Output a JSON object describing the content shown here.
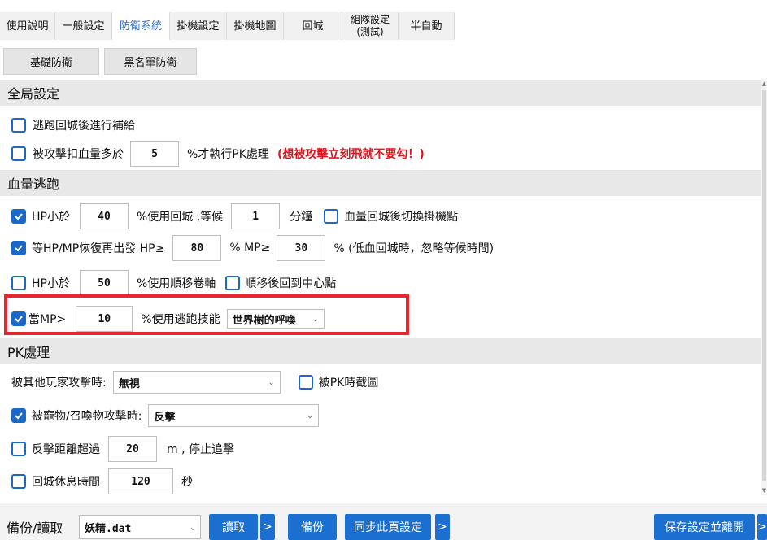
{
  "colors": {
    "accent": "#1a68c8",
    "active_tab_text": "#2f6fd1",
    "warning": "#e0141e",
    "highlight_box": "#e6282e"
  },
  "tabs": [
    {
      "label": "使用說明"
    },
    {
      "label": "一般設定"
    },
    {
      "label": "防衛系統",
      "active": true
    },
    {
      "label": "掛機設定"
    },
    {
      "label": "掛機地圖"
    },
    {
      "label": "回城"
    },
    {
      "label_line1": "組隊設定",
      "label_line2": "(測試)"
    },
    {
      "label": "半自動"
    }
  ],
  "subtabs": [
    "基礎防衛",
    "黑名單防衛"
  ],
  "global": {
    "header": "全局設定",
    "refill_after_return": {
      "label": "逃跑回城後進行補給",
      "checked": false
    },
    "pk_on_hit": {
      "label_before": "被攻擊扣血量多於",
      "value": "5",
      "label_after": "%才執行PK處理",
      "warning": "(想被攻擊立刻飛就不要勾！)",
      "checked": false
    }
  },
  "escape": {
    "header": "血量逃跑",
    "hp_return": {
      "label": "HP小於",
      "value": "40",
      "label_mid": "%使用回城 ,等候",
      "wait": "1",
      "unit": "分鐘",
      "checked": true,
      "switch_label": "血量回城後切換掛機點",
      "switch_checked": false
    },
    "recover": {
      "label": "等HP/MP恢復再出發 HP≥",
      "hp": "80",
      "mp_label": "% MP≥",
      "mp": "30",
      "note": "% (低血回城時，忽略等候時間)",
      "checked": true
    },
    "hp_teleport": {
      "label": "HP小於",
      "value": "50",
      "label_after": "%使用順移卷軸",
      "checked": false,
      "center_label": "順移後回到中心點",
      "center_checked": false
    },
    "mp_skill": {
      "label": "當MP>",
      "value": "10",
      "label_after": "%使用逃跑技能",
      "skill": "世界樹的呼喚",
      "checked": true
    }
  },
  "pk": {
    "header": "PK處理",
    "player_attack": {
      "label": "被其他玩家攻擊時:",
      "option": "無視",
      "screenshot_label": "被PK時截圖",
      "screenshot_checked": false
    },
    "pet_attack": {
      "label": "被寵物/召喚物攻擊時:",
      "option": "反擊",
      "checked": true
    },
    "chase": {
      "label": "反擊距離超過",
      "value": "20",
      "label_after": "m , 停止追擊",
      "checked": false
    },
    "rest": {
      "label": "回城休息時間",
      "value": "120",
      "unit": "秒",
      "checked": false
    }
  },
  "bottom": {
    "label": "備份/讀取",
    "file": "妖精.dat",
    "read": "讀取",
    "backup": "備份",
    "sync": "同步此頁設定",
    "arrow": ">",
    "save_exit": "保存設定並離開"
  }
}
